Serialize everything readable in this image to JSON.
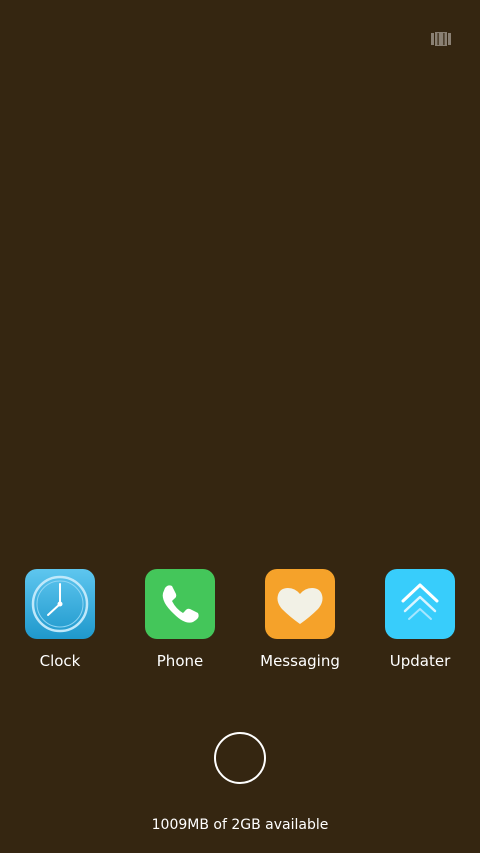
{
  "status_icon": {
    "name": "recent-apps-icon",
    "color": "#8a8073"
  },
  "apps": [
    {
      "label": "Clock",
      "icon": "clock-icon",
      "color": "#2ea6d6"
    },
    {
      "label": "Phone",
      "icon": "phone-icon",
      "color": "#44c65a"
    },
    {
      "label": "Messaging",
      "icon": "heart-icon",
      "color": "#f5a22a"
    },
    {
      "label": "Updater",
      "icon": "chevron-up-icon",
      "color": "#38cdfb"
    }
  ],
  "home_button": {
    "icon": "circle-icon"
  },
  "memory": {
    "text": "1009MB of 2GB available"
  },
  "background_color": "#352611"
}
